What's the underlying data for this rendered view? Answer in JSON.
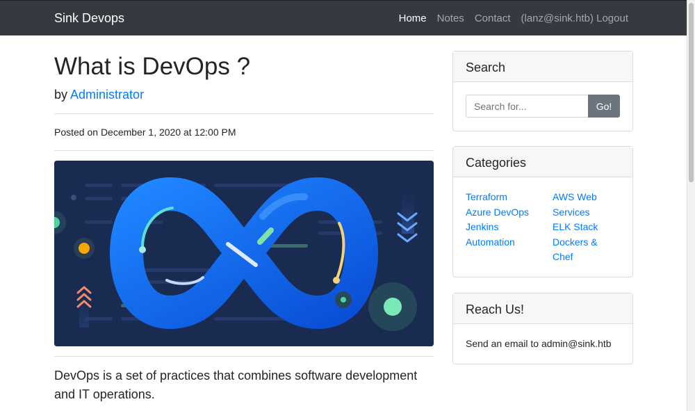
{
  "navbar": {
    "brand": "Sink Devops",
    "links": [
      {
        "label": "Home",
        "active": true
      },
      {
        "label": "Notes",
        "active": false
      },
      {
        "label": "Contact",
        "active": false
      },
      {
        "label": "(lanz@sink.htb) Logout",
        "active": false
      }
    ]
  },
  "post": {
    "title": "What is DevOps ?",
    "by_prefix": "by",
    "author": "Administrator",
    "posted": "Posted on December 1, 2020 at 12:00 PM",
    "image_icon": "devops-infinity-banner",
    "lead": "DevOps is a set of practices that combines software development and IT operations."
  },
  "search": {
    "title": "Search",
    "placeholder": "Search for...",
    "button": "Go!"
  },
  "categories": {
    "title": "Categories",
    "left": [
      "Terraform",
      "Azure DevOps",
      "Jenkins",
      "Automation"
    ],
    "right": [
      "AWS Web Services",
      "ELK Stack",
      "Dockers & Chef"
    ]
  },
  "reach": {
    "title": "Reach Us!",
    "text": "Send an email to admin@sink.htb"
  },
  "colors": {
    "navbar": "#343a40",
    "link": "#007bff",
    "button": "#6c757d",
    "banner_bg": "#1a2b52"
  }
}
